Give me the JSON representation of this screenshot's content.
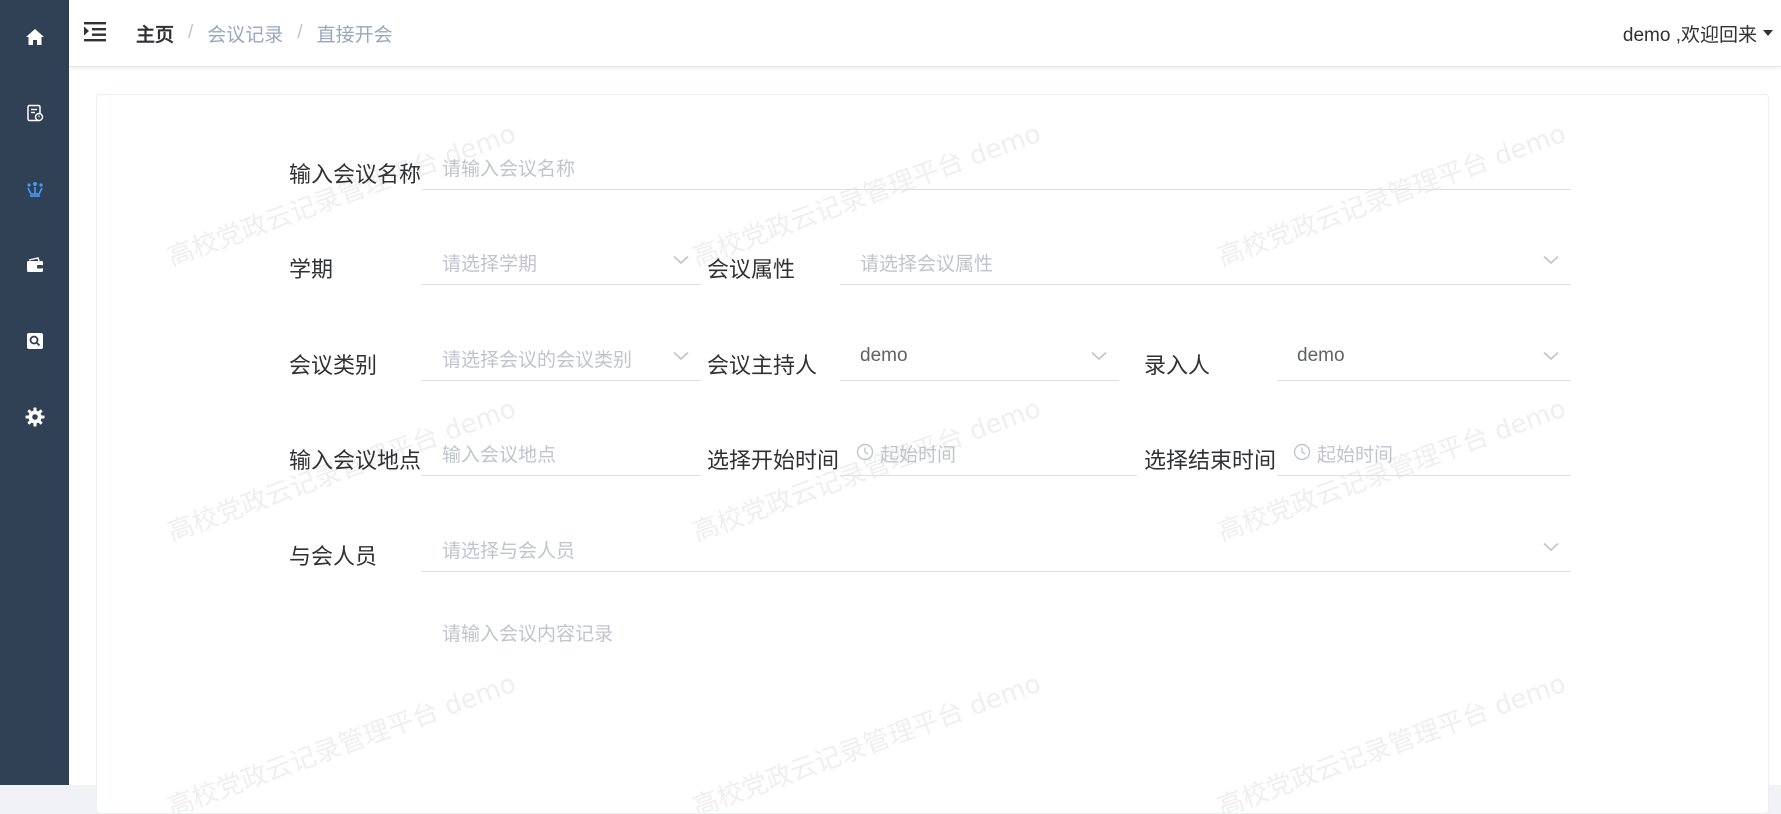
{
  "sidebar": {
    "items": [
      {
        "icon": "home-icon",
        "color": "#ffffff"
      },
      {
        "icon": "record-list-icon",
        "color": "#ffffff"
      },
      {
        "icon": "meeting-icon",
        "color": "#409eff"
      },
      {
        "icon": "wallet-icon",
        "color": "#ffffff"
      },
      {
        "icon": "search-box-icon",
        "color": "#ffffff"
      },
      {
        "icon": "gear-icon",
        "color": "#ffffff"
      }
    ]
  },
  "navbar": {
    "breadcrumb": {
      "home": "主页",
      "section": "会议记录",
      "current": "直接开会"
    },
    "user_greeting": "demo ,欢迎回来"
  },
  "watermark": {
    "text": "高校党政云记录管理平台 demo"
  },
  "form": {
    "meeting_name": {
      "label": "输入会议名称",
      "placeholder": "请输入会议名称"
    },
    "semester": {
      "label": "学期",
      "placeholder": "请选择学期"
    },
    "meeting_attr": {
      "label": "会议属性",
      "placeholder": "请选择会议属性"
    },
    "meeting_category": {
      "label": "会议类别",
      "placeholder": "请选择会议的会议类别"
    },
    "meeting_host": {
      "label": "会议主持人",
      "value": "demo"
    },
    "recorder": {
      "label": "录入人",
      "value": "demo"
    },
    "location": {
      "label": "输入会议地点",
      "placeholder": "输入会议地点"
    },
    "start_time": {
      "label": "选择开始时间",
      "placeholder": "起始时间"
    },
    "end_time": {
      "label": "选择结束时间",
      "placeholder": "起始时间"
    },
    "attendees": {
      "label": "与会人员",
      "placeholder": "请选择与会人员"
    },
    "content": {
      "placeholder": "请输入会议内容记录"
    }
  },
  "colors": {
    "sidebar_bg": "#304156",
    "active_icon": "#409eff",
    "placeholder": "#c0c4cc",
    "text": "#303133"
  }
}
